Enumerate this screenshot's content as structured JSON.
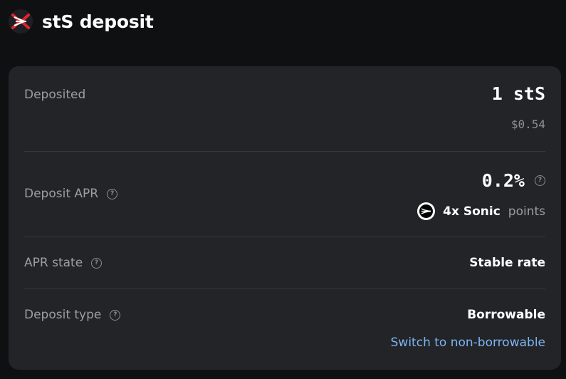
{
  "header": {
    "title": "stS deposit"
  },
  "deposited": {
    "label": "Deposited",
    "amount": "1 stS",
    "usd": "$0.54"
  },
  "deposit_apr": {
    "label": "Deposit APR",
    "value": "0.2%",
    "points_multiplier": "4x Sonic",
    "points_label": "points"
  },
  "apr_state": {
    "label": "APR state",
    "value": "Stable rate"
  },
  "deposit_type": {
    "label": "Deposit type",
    "value": "Borrowable",
    "switch_link": "Switch to non-borrowable"
  },
  "help_glyph": "?",
  "icons": {
    "logo": "sts-token-logo-icon",
    "sonic": "sonic-logo-icon",
    "help": "help-circle-icon"
  },
  "colors": {
    "background": "#0f1012",
    "card": "#222428",
    "label": "#9b9ea4",
    "link": "#7fb4f0",
    "logo_red": "#e0242b"
  }
}
